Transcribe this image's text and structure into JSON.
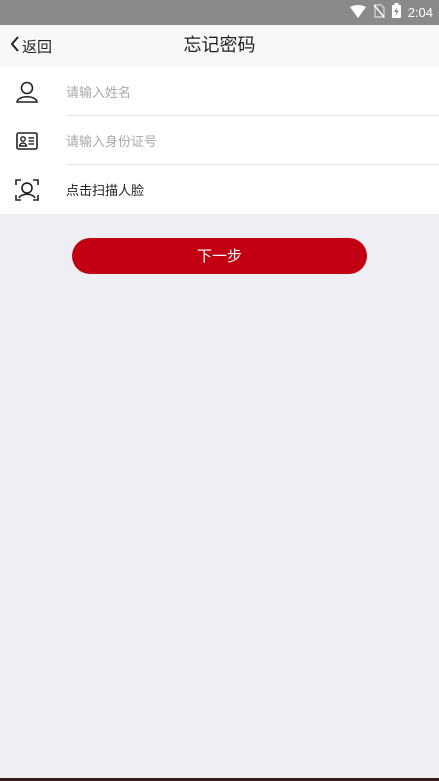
{
  "status_bar": {
    "time": "2:04",
    "icons": [
      "wifi-icon",
      "no-sim-icon",
      "battery-charging-icon"
    ]
  },
  "nav": {
    "back_label": "返回",
    "title": "忘记密码"
  },
  "form": {
    "name_placeholder": "请输入姓名",
    "id_placeholder": "请输入身份证号",
    "face_scan_label": "点击扫描人脸"
  },
  "next_button_label": "下一步",
  "colors": {
    "accent": "#c20012",
    "background": "#efeef4",
    "status_bar": "#8a8a8a"
  }
}
